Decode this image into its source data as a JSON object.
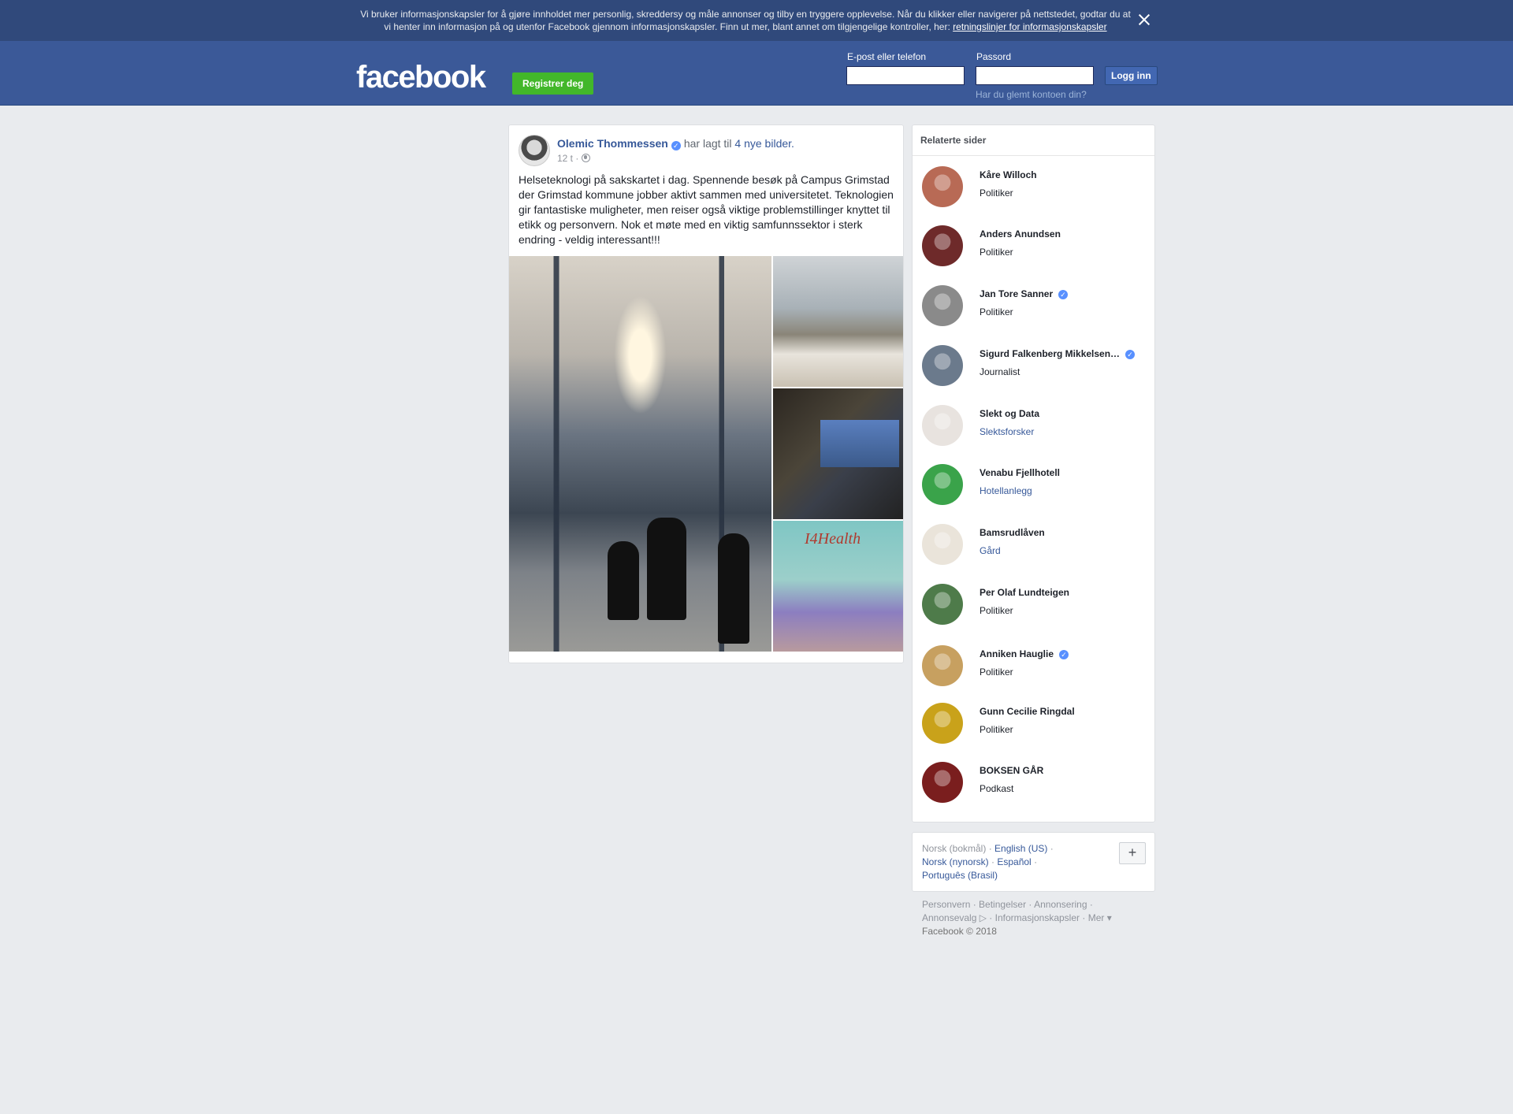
{
  "cookie_banner": {
    "text": "Vi bruker informasjonskapsler for å gjøre innholdet mer personlig, skreddersy og måle annonser og tilby en tryggere opplevelse. Når du klikker eller navigerer på nettstedet, godtar du at vi henter inn informasjon på og utenfor Facebook gjennom informasjonskapsler. Finn ut mer, blant annet om tilgjengelige kontroller, her:",
    "link": "retningslinjer for informasjonskapsler"
  },
  "header": {
    "logo": "facebook",
    "register": "Registrer deg",
    "email_label": "E-post eller telefon",
    "password_label": "Passord",
    "login": "Logg inn",
    "forgot": "Har du glemt kontoen din?"
  },
  "post": {
    "author": "Olemic Thommessen",
    "action": "har lagt til",
    "action_link": "4 nye bilder.",
    "time": "12 t ·",
    "text": "Helseteknologi på sakskartet i dag. Spennende besøk på Campus Grimstad der Grimstad kommune jobber aktivt sammen med universitetet. Teknologien gir fantastiske muligheter, men reiser også viktige problemstillinger knyttet til etikk og personvern. Nok et møte med en viktig samfunnssektor i sterk endring - veldig interessant!!!",
    "photo_caption": "I4Health"
  },
  "related": {
    "title": "Relaterte sider",
    "items": [
      {
        "name": "Kåre Willoch",
        "category": "Politiker",
        "verified": false,
        "link": false,
        "color": "#b86a55"
      },
      {
        "name": "Anders Anundsen",
        "category": "Politiker",
        "verified": false,
        "link": false,
        "color": "#6e2a2a"
      },
      {
        "name": "Jan Tore Sanner",
        "category": "Politiker",
        "verified": true,
        "link": false,
        "color": "#8a8a8a"
      },
      {
        "name": "Sigurd Falkenberg Mikkelsen…",
        "category": "Journalist",
        "verified": true,
        "link": false,
        "color": "#6b7a8c"
      },
      {
        "name": "Slekt og Data",
        "category": "Slektsforsker",
        "verified": false,
        "link": true,
        "color": "#e8e3df"
      },
      {
        "name": "Venabu Fjellhotell",
        "category": "Hotellanlegg",
        "verified": false,
        "link": true,
        "color": "#3aa34a"
      },
      {
        "name": "Bamsrudlåven",
        "category": "Gård",
        "verified": false,
        "link": true,
        "color": "#eae4da"
      },
      {
        "name": "Per Olaf Lundteigen",
        "category": "Politiker",
        "verified": false,
        "link": false,
        "color": "#4e7b4a"
      },
      {
        "name": "Anniken Hauglie",
        "category": "Politiker",
        "verified": true,
        "link": false,
        "color": "#c7a060"
      },
      {
        "name": "Gunn Cecilie Ringdal",
        "category": "Politiker",
        "verified": false,
        "link": false,
        "color": "#c9a21a"
      },
      {
        "name": "BOKSEN GÅR",
        "category": "Podkast",
        "verified": false,
        "link": false,
        "color": "#7a1e1e"
      }
    ]
  },
  "languages": {
    "current": "Norsk (bokmål)",
    "others": [
      "English (US)",
      "Norsk (nynorsk)",
      "Español",
      "Português (Brasil)"
    ],
    "add": "+"
  },
  "footer": {
    "links": [
      "Personvern",
      "Betingelser",
      "Annonsering",
      "Annonsevalg",
      "Informasjonskapsler",
      "Mer"
    ],
    "copyright": "Facebook © 2018"
  }
}
